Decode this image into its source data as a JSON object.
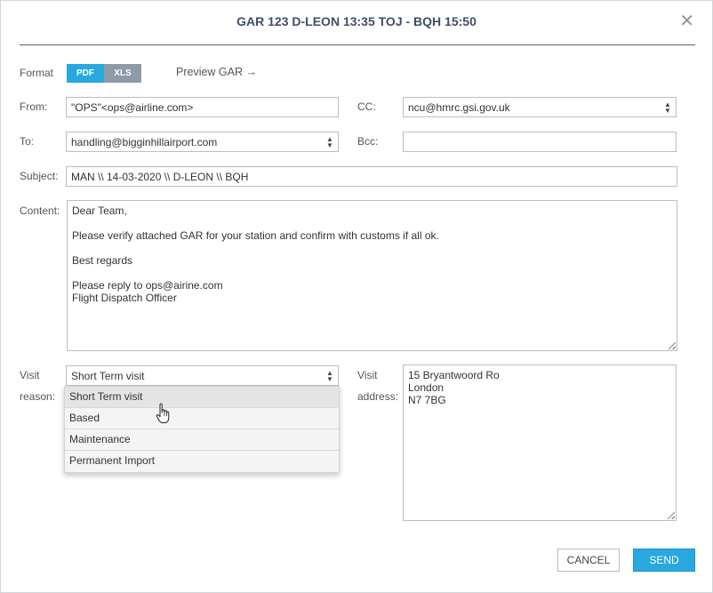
{
  "dialog": {
    "title": "GAR 123 D-LEON 13:35 TOJ - BQH 15:50",
    "close_symbol": "✕"
  },
  "format": {
    "label": "Format",
    "pdf_label": "PDF",
    "xls_label": "XLS",
    "selected": "PDF",
    "preview_label": "Preview GAR",
    "preview_arrow": "→"
  },
  "from": {
    "label": "From:",
    "value": "\"OPS\"<ops@airline.com>"
  },
  "cc": {
    "label": "CC:",
    "value": "ncu@hmrc.gsi.gov.uk"
  },
  "to": {
    "label": "To:",
    "value": "handling@bigginhillairport.com"
  },
  "bcc": {
    "label": "Bcc:",
    "value": ""
  },
  "subject": {
    "label": "Subject:",
    "value": "MAN \\\\ 14-03-2020 \\\\ D-LEON \\\\ BQH"
  },
  "content": {
    "label": "Content:",
    "lines": [
      "Dear Team,",
      "",
      "Please verify attached GAR for your station and confirm with customs if all ok.",
      "",
      "Best regards",
      "",
      "Please reply to ops@airine.com",
      "Flight Dispatch Officer"
    ]
  },
  "visit_reason": {
    "label_line1": "Visit",
    "label_line2": "reason:",
    "value": "Short Term visit",
    "options": [
      "Short Term visit",
      "Based",
      "Maintenance",
      "Permanent Import"
    ],
    "hovered_index": 0
  },
  "visit_address": {
    "label_line1": "Visit",
    "label_line2": "address:",
    "lines": [
      "15 Bryantwoord Ro",
      "London",
      "N7 7BG"
    ]
  },
  "buttons": {
    "cancel_label": "CANCEL",
    "send_label": "SEND"
  },
  "colors": {
    "accent": "#29a8e0",
    "title": "#3d4f66",
    "xls_inactive": "#8e9aa6",
    "send_border": "#1e93c8"
  }
}
